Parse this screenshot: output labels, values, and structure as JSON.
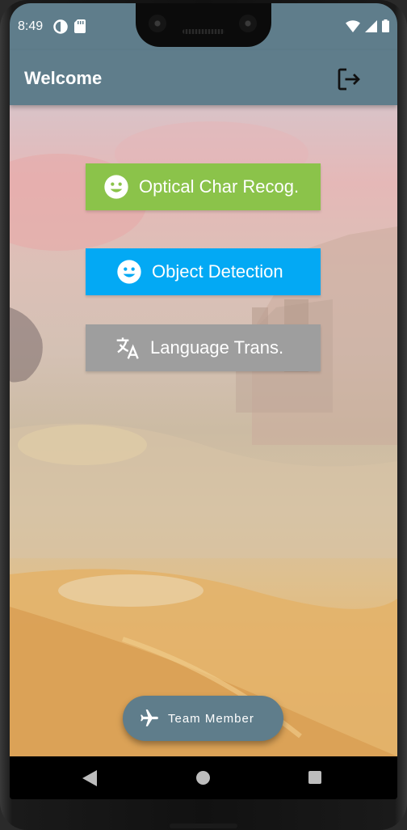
{
  "status_bar": {
    "time": "8:49",
    "left_icons": [
      "data-saver-icon",
      "sd-card-icon"
    ],
    "right_icons": [
      "wifi-icon",
      "signal-icon",
      "battery-icon"
    ]
  },
  "app_bar": {
    "title": "Welcome",
    "action_icon": "logout-icon"
  },
  "buttons": [
    {
      "label": "Optical Char Recog.",
      "icon": "smiley-face-icon",
      "color": "#8bc34a"
    },
    {
      "label": "Object Detection",
      "icon": "smiley-face-icon",
      "color": "#03a9f4"
    },
    {
      "label": "Language Trans.",
      "icon": "translate-icon",
      "color": "#9e9e9e"
    }
  ],
  "fab": {
    "label": "Team Member",
    "icon": "airplane-icon",
    "color": "#5f7d8b"
  },
  "nav_bar": {
    "buttons": [
      "back-icon",
      "home-icon",
      "recents-icon"
    ]
  },
  "colors": {
    "primary": "#5f7d8b"
  }
}
